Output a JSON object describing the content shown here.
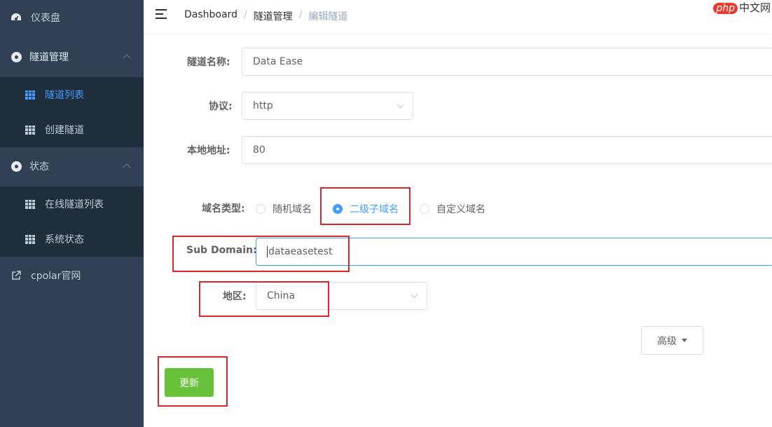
{
  "sidebar": {
    "items": [
      {
        "label": "仪表盘",
        "icon": "dashboard-icon"
      },
      {
        "label": "隧道管理",
        "icon": "tunnel-icon"
      },
      {
        "label": "隧道列表",
        "icon": "grid-icon"
      },
      {
        "label": "创建隧道",
        "icon": "grid-icon"
      },
      {
        "label": "状态",
        "icon": "status-icon"
      },
      {
        "label": "在线隧道列表",
        "icon": "grid-icon"
      },
      {
        "label": "系统状态",
        "icon": "grid-icon"
      },
      {
        "label": "cpolar官网",
        "icon": "external-link-icon"
      }
    ],
    "active_label": "隧道列表"
  },
  "header": {
    "breadcrumb": [
      "Dashboard",
      "隧道管理",
      "编辑隧道"
    ],
    "watermark_php": "php",
    "watermark_text": "中文网"
  },
  "form": {
    "name_label": "隧道名称:",
    "name_value": "Data Ease",
    "protocol_label": "协议:",
    "protocol_value": "http",
    "local_label": "本地地址:",
    "local_value": "80",
    "domain_type_label": "域名类型:",
    "domain_options": [
      "随机域名",
      "二级子域名",
      "自定义域名"
    ],
    "domain_selected": "二级子域名",
    "subdomain_label": "Sub Domain:",
    "subdomain_value": "dataeasetest",
    "region_label": "地区:",
    "region_value": "China",
    "advanced_label": "高级",
    "update_label": "更新"
  },
  "colors": {
    "sidebar_bg": "#304156",
    "submenu_bg": "#1f2d3d",
    "accent": "#409eff",
    "update_button": "#67c23a",
    "highlight_box": "#d9262d"
  }
}
